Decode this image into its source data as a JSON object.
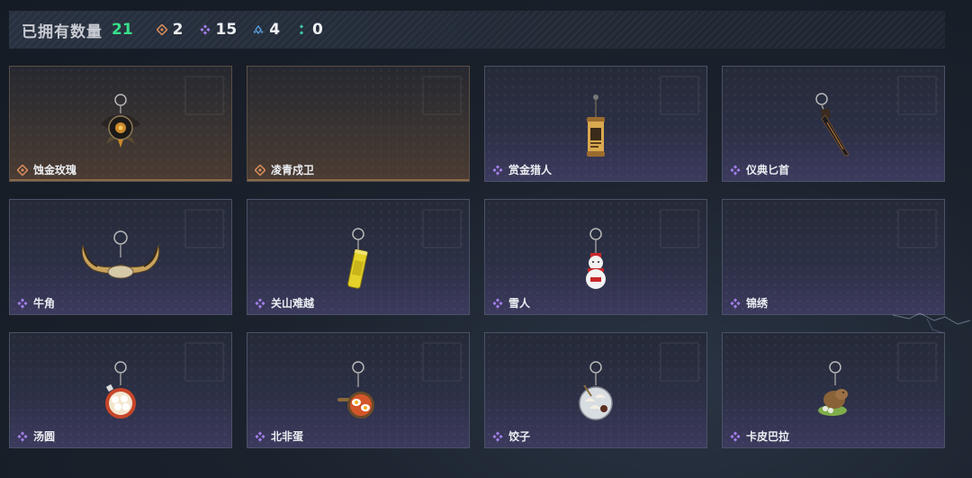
{
  "header": {
    "owned_label": "已拥有数量",
    "owned_count": "21",
    "rarity_counts": [
      {
        "icon": "gold-diamond-icon",
        "count": "2",
        "color": "#d48a5a"
      },
      {
        "icon": "purple-diamond-icon",
        "count": "15",
        "color": "#a27ee8"
      },
      {
        "icon": "blue-diamond-icon",
        "count": "4",
        "color": "#5aa0e0"
      },
      {
        "icon": "teal-dots-icon",
        "count": "0",
        "color": "#3cc8a8"
      }
    ]
  },
  "items": [
    {
      "name": "蚀金玫瑰",
      "rarity": "gold",
      "art": "rose-pendant-icon"
    },
    {
      "name": "凌青戍卫",
      "rarity": "gold",
      "art": ""
    },
    {
      "name": "赏金猎人",
      "rarity": "purple",
      "art": "wanted-poster-icon"
    },
    {
      "name": "仪典匕首",
      "rarity": "purple",
      "art": "dagger-icon"
    },
    {
      "name": "牛角",
      "rarity": "purple",
      "art": "horn-icon"
    },
    {
      "name": "关山难越",
      "rarity": "purple",
      "art": "yellow-can-icon"
    },
    {
      "name": "雪人",
      "rarity": "purple",
      "art": "snowman-icon"
    },
    {
      "name": "锦绣",
      "rarity": "purple",
      "art": ""
    },
    {
      "name": "汤圆",
      "rarity": "purple",
      "art": "tangyuan-bowl-icon"
    },
    {
      "name": "北非蛋",
      "rarity": "purple",
      "art": "shakshuka-icon"
    },
    {
      "name": "饺子",
      "rarity": "purple",
      "art": "dumpling-plate-icon"
    },
    {
      "name": "卡皮巴拉",
      "rarity": "purple",
      "art": "capybara-icon"
    }
  ],
  "colors": {
    "gold": "#d48a5a",
    "purple": "#a27ee8"
  }
}
